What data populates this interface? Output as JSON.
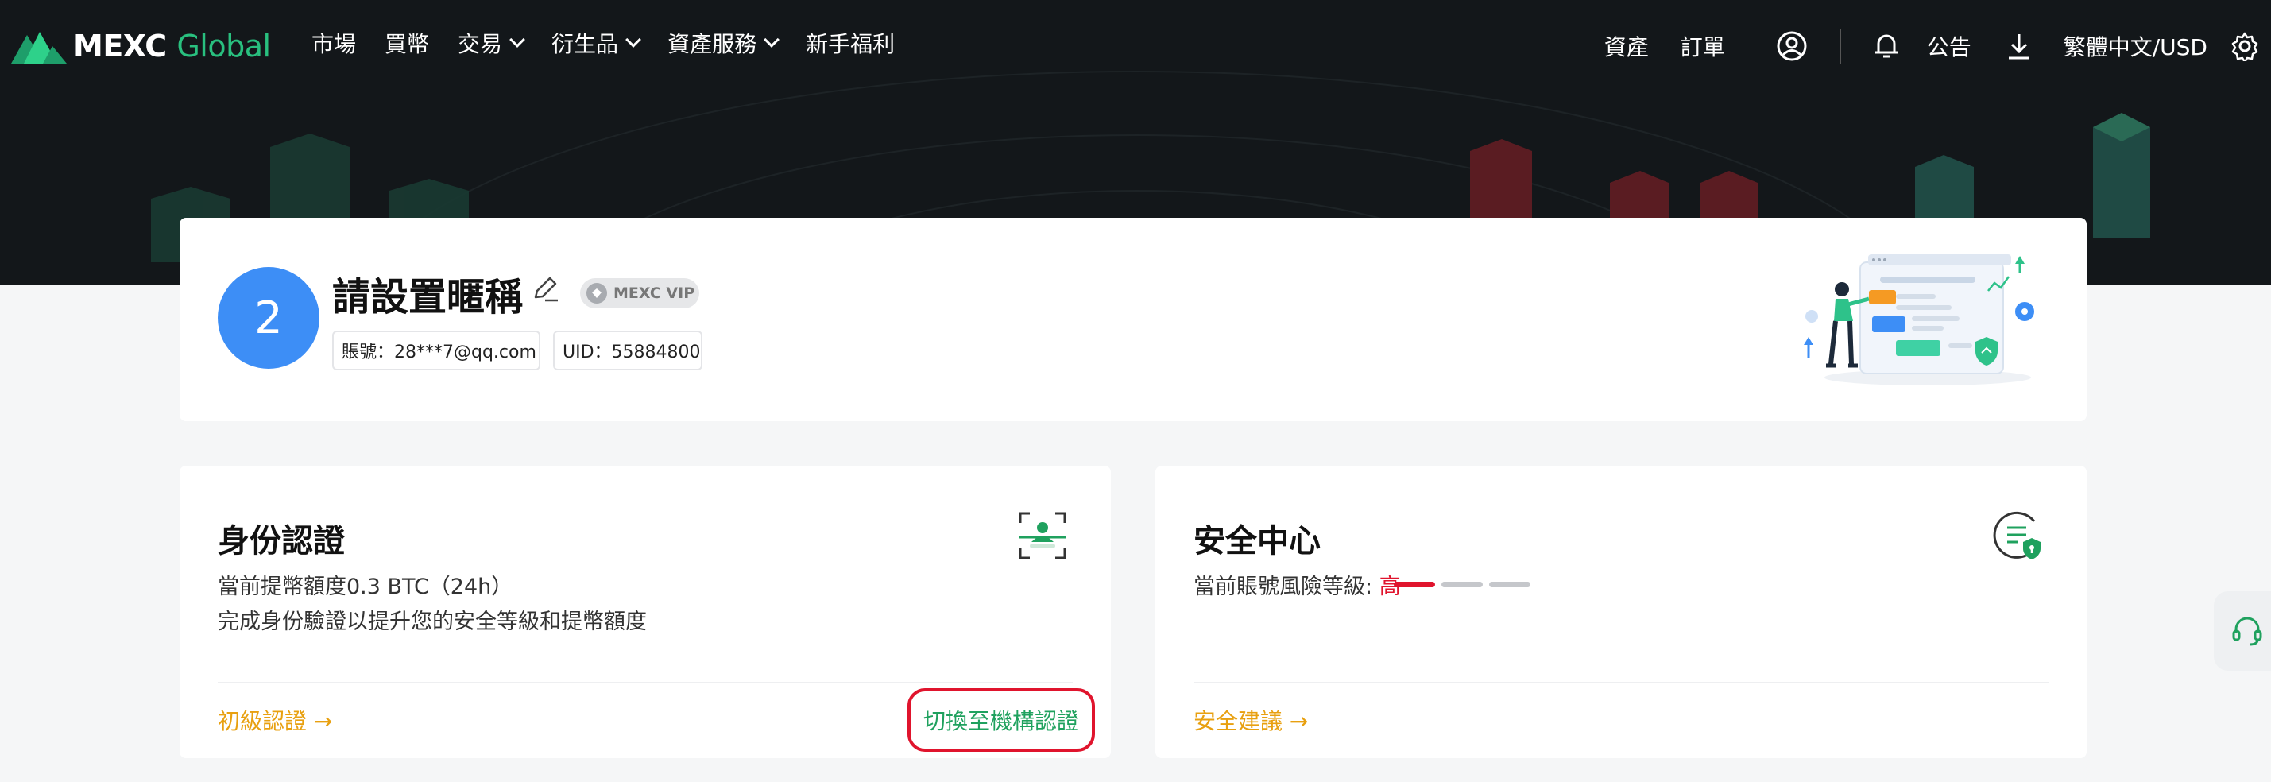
{
  "brand": {
    "name": "MEXC",
    "suffix": "Global",
    "accent": "#29c07f"
  },
  "nav": {
    "items": [
      {
        "label": "市場",
        "dropdown": false
      },
      {
        "label": "買幣",
        "dropdown": false
      },
      {
        "label": "交易",
        "dropdown": true
      },
      {
        "label": "衍生品",
        "dropdown": true
      },
      {
        "label": "資產服務",
        "dropdown": true
      },
      {
        "label": "新手福利",
        "dropdown": false
      }
    ],
    "right": {
      "assets": "資產",
      "orders": "訂單",
      "user_icon": "user-circle-icon",
      "bell_icon": "bell-icon",
      "announcements": "公告",
      "download_icon": "download-icon",
      "language": "繁體中文/USD",
      "settings_icon": "gear-icon"
    }
  },
  "profile": {
    "avatar_text": "2",
    "nickname": "請設置暱稱",
    "vip_badge": "MEXC VIP",
    "account": "賬號：28***7@qq.com",
    "uid": "UID：55884800",
    "avatar_color": "#3d8ef6"
  },
  "identity": {
    "title": "身份認證",
    "limit": "當前提幣額度0.3 BTC（24h）",
    "desc": "完成身份驗證以提升您的安全等級和提幣額度",
    "primary_link": "初級認證 →",
    "switch_link": "切換至機構認證"
  },
  "security": {
    "title": "安全中心",
    "risk_label": "當前賬號風險等級:",
    "risk_value": "高",
    "risk_level": 1,
    "risk_levels_total": 3,
    "advice_link": "安全建議 →"
  },
  "colors": {
    "warning": "#e8a010",
    "danger": "#e0142d",
    "success": "#1fa15e",
    "header_bg": "#13171a"
  }
}
